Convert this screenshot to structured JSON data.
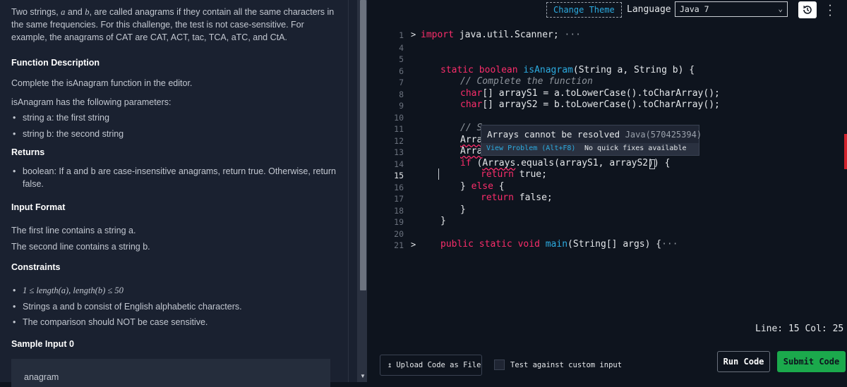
{
  "problem": {
    "intro_1": "Two strings, ",
    "var_a": "a",
    "intro_2": " and ",
    "var_b": "b",
    "intro_3": ", are called anagrams if they contain all the same characters in the same frequencies. For this challenge, the test is not case-sensitive. For example, the anagrams of CAT are CAT, ACT, tac, TCA, aTC, and CtA.",
    "function_heading": "Function Description",
    "function_text": "Complete the isAnagram function in the editor.",
    "params_text": "isAnagram has the following parameters:",
    "params": [
      "string a: the first string",
      "string b: the second string"
    ],
    "returns_heading": "Returns",
    "returns": [
      "boolean: If a and b are case-insensitive anagrams, return true. Otherwise, return false."
    ],
    "input_heading": "Input Format",
    "input_line_1": "The first line contains a string a.",
    "input_line_2": "The second line contains a string b.",
    "constraints_heading": "Constraints",
    "constraints": [
      "1 ≤ length(a), length(b) ≤ 50",
      "Strings a and b consist of English alphabetic characters.",
      "The comparison should NOT be case sensitive."
    ],
    "sample_heading": "Sample Input 0",
    "sample_value": "anagram"
  },
  "toolbar": {
    "change_theme": "Change Theme",
    "language_label": "Language",
    "language_value": "Java 7"
  },
  "editor": {
    "line_numbers": [
      "1",
      "4",
      "5",
      "6",
      "7",
      "8",
      "9",
      "10",
      "11",
      "12",
      "13",
      "14",
      "15",
      "16",
      "17",
      "18",
      "19",
      "20",
      "21"
    ],
    "lines": {
      "l1_kw": "import",
      "l1_rest": " java.util.Scanner;",
      "l1_ellipsis": "···",
      "l6_kw1": "static",
      "l6_kw2": "boolean",
      "l6_fn": "isAnagram",
      "l6_rest": "(String a, String b) {",
      "l7": "// Complete the function",
      "l8_kw": "char",
      "l8_rest": "[] arrayS1 = a.toLowerCase().toCharArray();",
      "l9_kw": "char",
      "l9_rest": "[] arrayS2 = b.toLowerCase().toCharArray();",
      "l11": "// S",
      "l12": "Arra",
      "l13": "Arra",
      "l14_kw": "if",
      "l14_rest_1": " (",
      "l14_arrays": "Arrays",
      "l14_rest_2": ".equals(arrayS1, arrayS2)) ",
      "l14_brace": "{",
      "l15_kw": "return",
      "l15_rest": " true;",
      "l16_brace": "}",
      "l16_kw": "else",
      "l16_rest": " {",
      "l17_kw": "return",
      "l17_rest": " false;",
      "l18": "}",
      "l19": "}",
      "l21_kw1": "public",
      "l21_kw2": "static",
      "l21_kw3": "void",
      "l21_fn": "main",
      "l21_rest": "(String[] args) {",
      "l21_ellipsis": "···"
    },
    "fold_marker": ">"
  },
  "hover": {
    "message": "Arrays cannot be resolved",
    "code": "Java(570425394)",
    "view_problem": "View Problem (Alt+F8)",
    "no_fixes": "No quick fixes available"
  },
  "status": {
    "text": "Line: 15 Col: 25"
  },
  "bottom": {
    "upload": "Upload Code as File",
    "custom_input": "Test against custom input",
    "run": "Run Code",
    "submit": "Submit Code"
  },
  "colors": {
    "keyword": "#f92d6a",
    "function": "#2cabe0",
    "submit": "#1ba94c",
    "error": "#d2222d"
  }
}
